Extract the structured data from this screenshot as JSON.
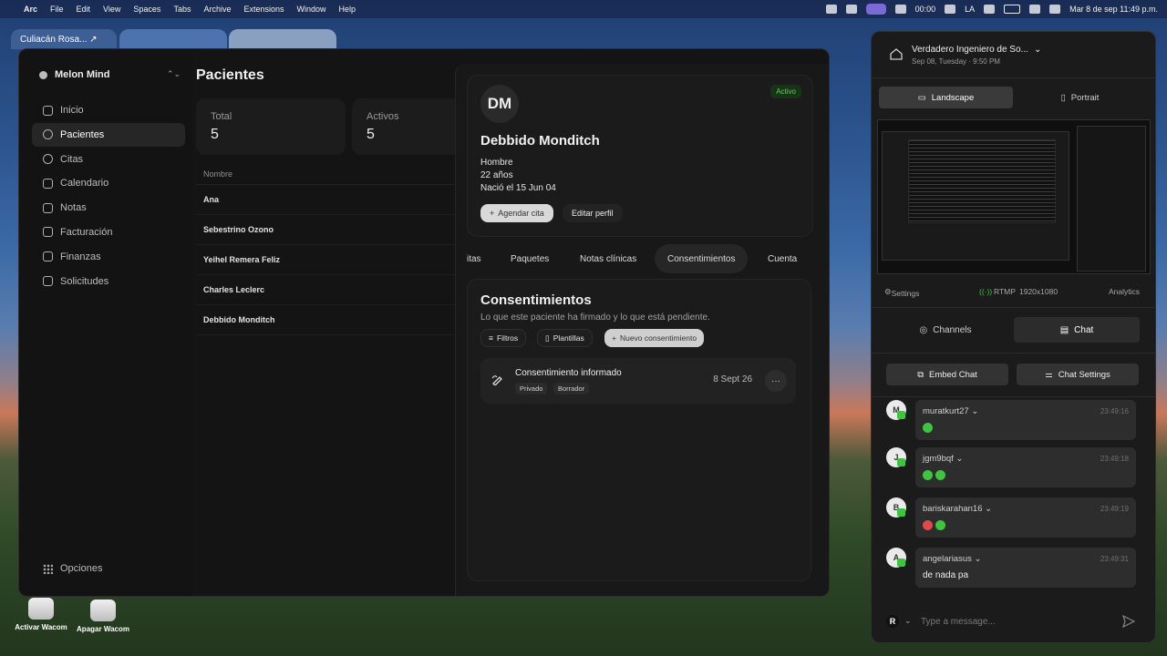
{
  "menubar": {
    "app": "Arc",
    "menus": [
      "File",
      "Edit",
      "View",
      "Spaces",
      "Tabs",
      "Archive",
      "Extensions",
      "Window",
      "Help"
    ],
    "clock_small": "00:00",
    "lang": "LA",
    "datetime": "Mar 8 de sep  11:49 p.m."
  },
  "bg_tabs": {
    "weather": "Culiacán Rosa... ↗"
  },
  "sidebar": {
    "brand": "Melon Mind",
    "items": [
      {
        "label": "Inicio",
        "icon": "home-icon"
      },
      {
        "label": "Pacientes",
        "icon": "users-icon"
      },
      {
        "label": "Citas",
        "icon": "clock-icon"
      },
      {
        "label": "Calendario",
        "icon": "calendar-icon"
      },
      {
        "label": "Notas",
        "icon": "notes-icon"
      },
      {
        "label": "Facturación",
        "icon": "receipt-icon"
      },
      {
        "label": "Finanzas",
        "icon": "finance-icon"
      },
      {
        "label": "Solicitudes",
        "icon": "mail-icon"
      }
    ],
    "options_label": "Opciones"
  },
  "main": {
    "title": "Pacientes",
    "stats": [
      {
        "label": "Total",
        "value": "5"
      },
      {
        "label": "Activos",
        "value": "5"
      }
    ],
    "table_header": "Nombre",
    "patients": [
      "Ana",
      "Sebestrino Ozono",
      "Yeihel Remera Feliz",
      "Charles Leclerc",
      "Debbido Monditch"
    ]
  },
  "profile": {
    "initials": "DM",
    "status": "Activo",
    "name": "Debbido Monditch",
    "gender": "Hombre",
    "age": "22 años",
    "born": "Nació el 15 Jun 04",
    "btn_schedule": "Agendar cita",
    "btn_edit": "Editar perfil"
  },
  "tabs": [
    "itas",
    "Paquetes",
    "Notas clínicas",
    "Consentimientos",
    "Cuenta"
  ],
  "consents": {
    "title": "Consentimientos",
    "subtitle": "Lo que este paciente ha firmado y lo que está pendiente.",
    "btn_filters": "Filtros",
    "btn_templates": "Plantillas",
    "btn_new": "Nuevo consentimiento",
    "doc": {
      "title": "Consentimiento informado",
      "tags": [
        "Privado",
        "Borrador"
      ],
      "date": "8 Sept 26",
      "more": "···"
    }
  },
  "desktop": {
    "icon1": "Activar Wacom",
    "icon2": "Apagar Wacom"
  },
  "stream": {
    "title": "Verdadero Ingeniero de So...",
    "date": "Sep 08, Tuesday · 9:50 PM",
    "landscape": "Landscape",
    "portrait": "Portrait",
    "settings": "Settings",
    "rtmp": "RTMP",
    "resolution": "1920x1080",
    "analytics": "Analytics",
    "channels": "Channels",
    "chat": "Chat",
    "embed_chat": "Embed Chat",
    "chat_settings": "Chat Settings",
    "messages": [
      {
        "initial": "M",
        "user": "muratkurt27",
        "time": "23:49:16",
        "text": ""
      },
      {
        "initial": "J",
        "user": "jgm9bqf",
        "time": "23:49:18",
        "text": ""
      },
      {
        "initial": "B",
        "user": "bariskarahan16",
        "time": "23:49:19",
        "text": ""
      },
      {
        "initial": "A",
        "user": "angelariasus",
        "time": "23:49:31",
        "text": "de nada pa"
      }
    ],
    "account_initial": "R",
    "placeholder": "Type a message..."
  },
  "colors": {
    "active_badge": "#58d258",
    "twitch_green": "#3ec43e",
    "menubar_pill": "#7b6ad6"
  }
}
